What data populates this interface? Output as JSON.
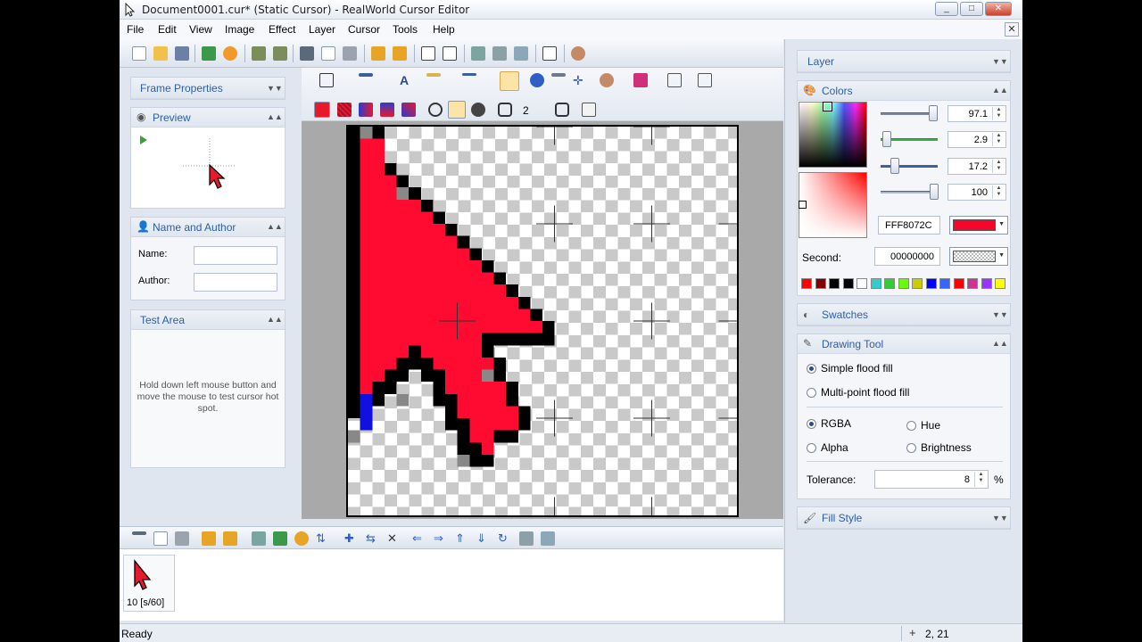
{
  "window": {
    "title": "Document0001.cur* (Static Cursor) - RealWorld Cursor Editor",
    "min": "_",
    "max": "□",
    "close": "✕",
    "doc_close": "✕"
  },
  "menu": [
    "File",
    "Edit",
    "View",
    "Image",
    "Effect",
    "Layer",
    "Cursor",
    "Tools",
    "Help"
  ],
  "left_panels": {
    "frame_properties": "Frame Properties",
    "preview": "Preview",
    "name_author": {
      "title": "Name and Author",
      "name_label": "Name:",
      "author_label": "Author:",
      "name_value": "",
      "author_value": ""
    },
    "test_area": {
      "title": "Test Area",
      "hint": "Hold down left mouse button and move the mouse to test cursor hot spot."
    }
  },
  "canvas_toolbar": {
    "brush_size": "2"
  },
  "frames": {
    "label": "10 [s/60]"
  },
  "status": {
    "text": "Ready",
    "coords": "2, 21"
  },
  "right_panels": {
    "layer": "Layer",
    "colors": {
      "title": "Colors",
      "values": [
        "97.1",
        "2.9",
        "17.2",
        "100"
      ],
      "hex": "FFF8072C",
      "primary_color": "#f5072c",
      "second_label": "Second:",
      "second_hex": "00000000",
      "palette": [
        "#ff0000",
        "#800000",
        "#000000",
        "#000000",
        "#ffffff",
        "#33cccc",
        "#33cc33",
        "#66ff00",
        "#cccc00",
        "#0000ff",
        "#3366ff",
        "#ff0000",
        "#cc3399",
        "#9933ff",
        "#ffff00"
      ]
    },
    "swatches": "Swatches",
    "drawing_tool": {
      "title": "Drawing Tool",
      "simple_fill": "Simple flood fill",
      "multi_fill": "Multi-point flood fill",
      "rgba": "RGBA",
      "hue": "Hue",
      "alpha": "Alpha",
      "brightness": "Brightness",
      "tolerance_label": "Tolerance:",
      "tolerance_value": "8",
      "percent": "%"
    },
    "fill_style": "Fill Style"
  }
}
